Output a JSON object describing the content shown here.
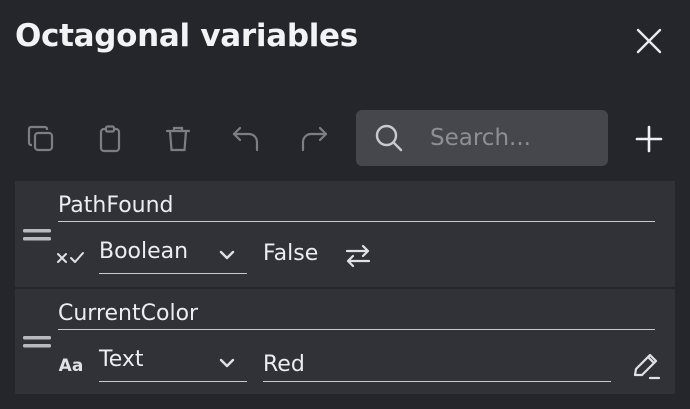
{
  "dialog": {
    "title": "Octagonal variables",
    "close_icon": "close-icon"
  },
  "toolbar": {
    "icons": [
      "copy-icon",
      "paste-icon",
      "delete-icon",
      "undo-icon",
      "redo-icon",
      "add-icon"
    ],
    "search": {
      "placeholder": "Search...",
      "value": "",
      "icon": "search-icon"
    }
  },
  "variables": [
    {
      "name": "PathFound",
      "type_icon": "boolean-type-icon",
      "type": "Boolean",
      "value": "False",
      "action_icon": "toggle-icon"
    },
    {
      "name": "CurrentColor",
      "type_icon": "text-type-icon",
      "type_icon_glyph": "Aa",
      "type": "Text",
      "value": "Red",
      "action_icon": "edit-icon"
    }
  ],
  "colors": {
    "background": "#25262b",
    "row": "#313237",
    "search_bg": "#46474d",
    "text": "#ececf1",
    "disabled_icon": "#7d7e84"
  }
}
